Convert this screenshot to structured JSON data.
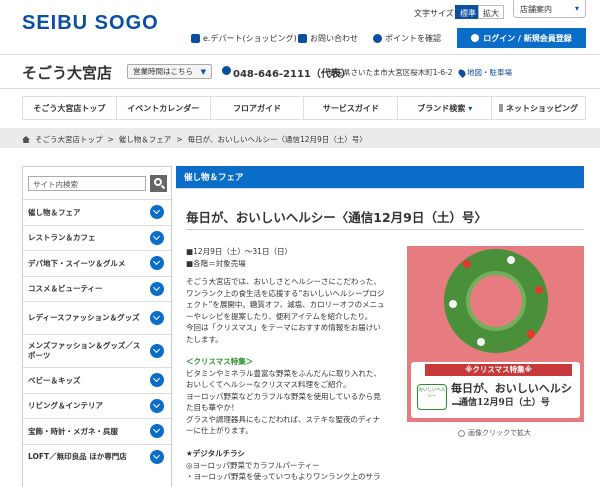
{
  "header": {
    "logo": "SEIBU SOGO",
    "font_size_label": "文字サイズ",
    "font_size_options": [
      "標準",
      "拡大"
    ],
    "store_info_label": "店舗案内",
    "util_links": {
      "edepart": "e.デパート(ショッピング)",
      "contact": "お問い合わせ",
      "points": "ポイントを確認",
      "login": "ログイン / 新規会員登録"
    }
  },
  "store": {
    "name": "そごう大宮店",
    "hours_label": "営業時間はこちら",
    "phone": "048-646-2111（代表）",
    "address": "埼玉県さいたま市大宮区桜木町1-6-2",
    "map_link": "地図・駐車場"
  },
  "gnav": [
    "そごう大宮店トップ",
    "イベントカレンダー",
    "フロアガイド",
    "サービスガイド",
    "ブランド検索",
    "ネットショッピング"
  ],
  "breadcrumb": {
    "home": "そごう大宮店トップ",
    "category": "催し物＆フェア",
    "current": "毎日が、おいしいヘルシー〈通信12月9日（土）号〉"
  },
  "sidebar": {
    "search_placeholder": "サイト内検索",
    "items": [
      "催し物＆フェア",
      "レストラン＆カフェ",
      "デパ地下・スイーツ＆グルメ",
      "コスメ＆ビューティー",
      "レディースファッション＆グッズ",
      "メンズファッション＆グッズ／スポーツ",
      "ベビー＆キッズ",
      "リビング＆インテリア",
      "宝飾・時計・メガネ・呉服",
      "LOFT／無印良品 ほか専門店"
    ]
  },
  "main": {
    "category_header": "催し物＆フェア",
    "title": "毎日が、おいしいヘルシー〈通信12月9日（土）号〉",
    "period": "■12月9日（土）～31日（日）",
    "venue": "■各階＝対象売場",
    "intro": [
      "そごう大宮店では、おいしさとヘルシーさにこだわった、",
      "ワンランク上の食生活を応援する“おいしいヘルシープロジ",
      "ェクト”を展開中。糖質オフ、減塩、カロリーオフのメニュ",
      "ーやレシピを提案したり、便利アイテムを紹介したり。",
      "今回は「クリスマス」をテーマにおすすめ情報をお届けい",
      "たします。"
    ],
    "xmas_heading": "＜クリスマス特集＞",
    "xmas_body": [
      "ビタミンやミネラル豊富な野菜をふんだんに取り入れた、",
      "おいしくてヘルシーなクリスマス料理をご紹介。",
      "ヨーロッパ野菜などカラフルな野菜を使用しているから見",
      "た目も華やか！",
      "グラスや調理器具にもこだわれば、ステキな聖夜のディナ",
      "ーに仕上がります。"
    ],
    "digital_heading": "★デジタルチラシ",
    "digital_items": [
      "◎ヨーロッパ野菜でカラフルパーティー",
      "・ヨーロッパ野菜を使っていつもよりワンランク上のサラ"
    ],
    "banner": {
      "ribbon": "※クリスマス特集※",
      "logo": "おいしいヘルシー",
      "title": "毎日が、おいしいヘルシー",
      "subtitle": "通信12月9日（土）号"
    },
    "zoom_hint": "画像クリックで拡大"
  }
}
